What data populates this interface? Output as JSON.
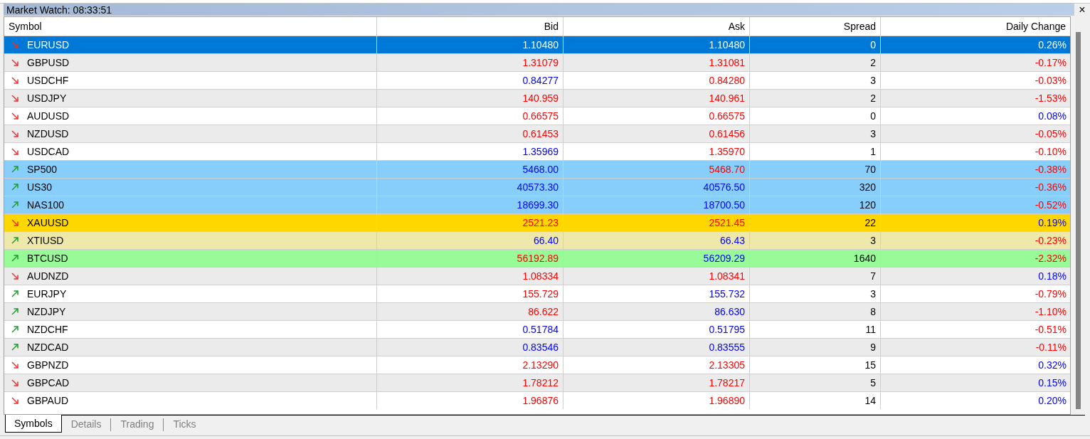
{
  "window": {
    "title": "Market Watch: 08:33:51",
    "close": "×"
  },
  "columns": [
    "Symbol",
    "Bid",
    "Ask",
    "Spread",
    "Daily Change"
  ],
  "rows": [
    {
      "symbol": "EURUSD",
      "rising": false,
      "bid": "1.10480",
      "bid_up": false,
      "ask": "1.10480",
      "ask_up": false,
      "spread": "0",
      "change": "0.26%",
      "change_up": true,
      "selected": true
    },
    {
      "symbol": "GBPUSD",
      "rising": false,
      "bid": "1.31079",
      "bid_up": false,
      "ask": "1.31081",
      "ask_up": false,
      "spread": "2",
      "change": "-0.17%",
      "change_up": false,
      "selected": false
    },
    {
      "symbol": "USDCHF",
      "rising": false,
      "bid": "0.84277",
      "bid_up": true,
      "ask": "0.84280",
      "ask_up": false,
      "spread": "3",
      "change": "-0.03%",
      "change_up": false,
      "selected": false
    },
    {
      "symbol": "USDJPY",
      "rising": false,
      "bid": "140.959",
      "bid_up": false,
      "ask": "140.961",
      "ask_up": false,
      "spread": "2",
      "change": "-1.53%",
      "change_up": false,
      "selected": false
    },
    {
      "symbol": "AUDUSD",
      "rising": false,
      "bid": "0.66575",
      "bid_up": false,
      "ask": "0.66575",
      "ask_up": false,
      "spread": "0",
      "change": "0.08%",
      "change_up": true,
      "selected": false
    },
    {
      "symbol": "NZDUSD",
      "rising": false,
      "bid": "0.61453",
      "bid_up": false,
      "ask": "0.61456",
      "ask_up": false,
      "spread": "3",
      "change": "-0.05%",
      "change_up": false,
      "selected": false
    },
    {
      "symbol": "USDCAD",
      "rising": false,
      "bid": "1.35969",
      "bid_up": true,
      "ask": "1.35970",
      "ask_up": false,
      "spread": "1",
      "change": "-0.10%",
      "change_up": false,
      "selected": false
    },
    {
      "symbol": "SP500",
      "rising": true,
      "bid": "5468.00",
      "bid_up": true,
      "ask": "5468.70",
      "ask_up": false,
      "spread": "70",
      "change": "-0.38%",
      "change_up": false,
      "selected": false,
      "color": "#87cefa"
    },
    {
      "symbol": "US30",
      "rising": true,
      "bid": "40573.30",
      "bid_up": true,
      "ask": "40576.50",
      "ask_up": true,
      "spread": "320",
      "change": "-0.36%",
      "change_up": false,
      "selected": false,
      "color": "#87cefa"
    },
    {
      "symbol": "NAS100",
      "rising": true,
      "bid": "18699.30",
      "bid_up": true,
      "ask": "18700.50",
      "ask_up": true,
      "spread": "120",
      "change": "-0.52%",
      "change_up": false,
      "selected": false,
      "color": "#87cefa"
    },
    {
      "symbol": "XAUUSD",
      "rising": false,
      "bid": "2521.23",
      "bid_up": false,
      "ask": "2521.45",
      "ask_up": false,
      "spread": "22",
      "change": "0.19%",
      "change_up": true,
      "selected": false,
      "color": "#ffd700"
    },
    {
      "symbol": "XTIUSD",
      "rising": true,
      "bid": "66.40",
      "bid_up": true,
      "ask": "66.43",
      "ask_up": true,
      "spread": "3",
      "change": "-0.23%",
      "change_up": false,
      "selected": false,
      "color": "#eee8aa"
    },
    {
      "symbol": "BTCUSD",
      "rising": true,
      "bid": "56192.89",
      "bid_up": false,
      "ask": "56209.29",
      "ask_up": true,
      "spread": "1640",
      "change": "-2.32%",
      "change_up": false,
      "selected": false,
      "color": "#98fb98"
    },
    {
      "symbol": "AUDNZD",
      "rising": false,
      "bid": "1.08334",
      "bid_up": false,
      "ask": "1.08341",
      "ask_up": false,
      "spread": "7",
      "change": "0.18%",
      "change_up": true,
      "selected": false
    },
    {
      "symbol": "EURJPY",
      "rising": true,
      "bid": "155.729",
      "bid_up": false,
      "ask": "155.732",
      "ask_up": true,
      "spread": "3",
      "change": "-0.79%",
      "change_up": false,
      "selected": false
    },
    {
      "symbol": "NZDJPY",
      "rising": true,
      "bid": "86.622",
      "bid_up": false,
      "ask": "86.630",
      "ask_up": true,
      "spread": "8",
      "change": "-1.10%",
      "change_up": false,
      "selected": false
    },
    {
      "symbol": "NZDCHF",
      "rising": true,
      "bid": "0.51784",
      "bid_up": true,
      "ask": "0.51795",
      "ask_up": true,
      "spread": "11",
      "change": "-0.51%",
      "change_up": false,
      "selected": false
    },
    {
      "symbol": "NZDCAD",
      "rising": true,
      "bid": "0.83546",
      "bid_up": true,
      "ask": "0.83555",
      "ask_up": true,
      "spread": "9",
      "change": "-0.11%",
      "change_up": false,
      "selected": false
    },
    {
      "symbol": "GBPNZD",
      "rising": false,
      "bid": "2.13290",
      "bid_up": false,
      "ask": "2.13305",
      "ask_up": false,
      "spread": "15",
      "change": "0.32%",
      "change_up": true,
      "selected": false
    },
    {
      "symbol": "GBPCAD",
      "rising": false,
      "bid": "1.78212",
      "bid_up": false,
      "ask": "1.78217",
      "ask_up": false,
      "spread": "5",
      "change": "0.15%",
      "change_up": true,
      "selected": false
    },
    {
      "symbol": "GBPAUD",
      "rising": false,
      "bid": "1.96876",
      "bid_up": false,
      "ask": "1.96890",
      "ask_up": false,
      "spread": "14",
      "change": "0.20%",
      "change_up": true,
      "selected": false
    }
  ],
  "tabs": [
    {
      "label": "Symbols",
      "selected": true
    },
    {
      "label": "Details",
      "selected": false
    },
    {
      "label": "Trading",
      "selected": false
    },
    {
      "label": "Ticks",
      "selected": false
    }
  ]
}
